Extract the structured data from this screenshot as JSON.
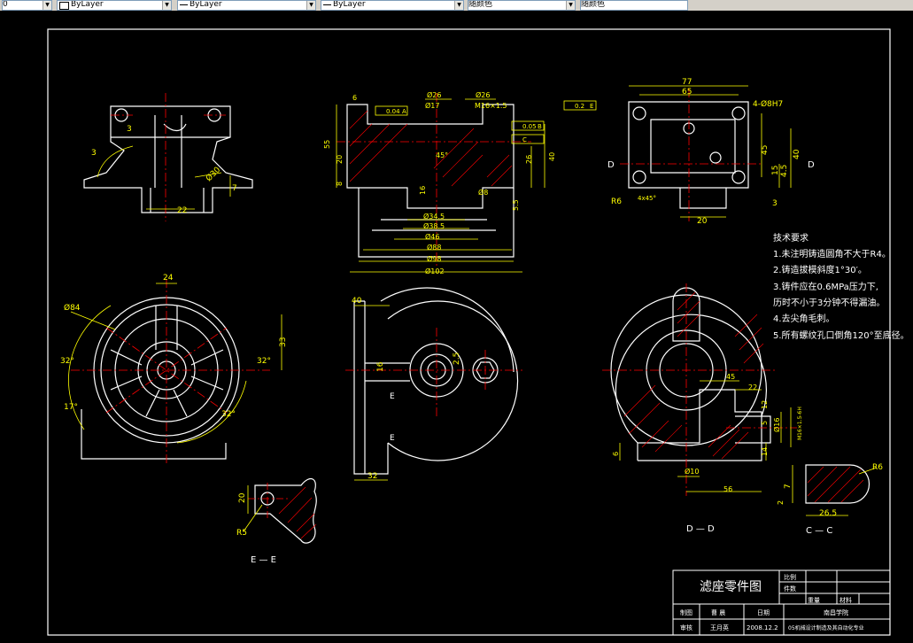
{
  "toolbar": {
    "layer_value": "0",
    "color_value": "ByLayer",
    "linetype_value": "ByLayer",
    "lineweight_value": "ByLayer",
    "plotstyle_value": "随颜色"
  },
  "colors": {
    "background": "#000000",
    "outline": "#ffffff",
    "dimension": "#ffff00",
    "centerline": "#ff0000",
    "hatch": "#ff0000",
    "border": "#ffffff"
  },
  "top_section": {
    "dims": {
      "d26a": "Ø26",
      "d17": "Ø17",
      "d26b": "Ø26",
      "t1": "6",
      "s55": "55",
      "s20": "20",
      "s8": "8",
      "s16": "16",
      "s5_5": "5.5",
      "s26": "26",
      "s40": "40",
      "s45": "45°",
      "d8": "Ø8",
      "m16": "M16×1.5",
      "d34_5": "Ø34.5",
      "d38_5": "Ø38.5",
      "d46": "Ø46",
      "d88": "Ø88",
      "d98": "Ø98",
      "d102": "Ø102",
      "tol_a": "0.04",
      "tol_b": "0.2",
      "tol_c": "0.05",
      "ref_a": "A",
      "ref_b": "B",
      "ref_e": "E",
      "ref_c": "C"
    }
  },
  "top_right_view": {
    "dims": {
      "w77": "77",
      "w65": "65",
      "holes": "4-Ø8H7",
      "h45": "45",
      "h40": "40",
      "h15": "15",
      "h4_5": "4.5",
      "h3": "3",
      "w20": "20",
      "r6": "R6",
      "c45": "4x45°",
      "sec_d_left": "D",
      "sec_d_right": "D"
    }
  },
  "top_left_view": {
    "dims": {
      "r3a": "3",
      "r3b": "3",
      "d30": "Ø30",
      "s7": "7",
      "w22": "22"
    }
  },
  "mid_left_view": {
    "dims": {
      "d84": "Ø84",
      "w24": "24",
      "h33": "33",
      "a32a": "32°",
      "a32b": "32°",
      "a32c": "32°",
      "a17": "17°"
    }
  },
  "mid_center_view": {
    "dims": {
      "w40": "40",
      "s16": "16",
      "r2_5": "2.5",
      "w32": "32",
      "sec_e_top": "E",
      "sec_e_bot": "E"
    }
  },
  "mid_right_view": {
    "dims": {
      "w45": "45",
      "w22": "22",
      "d16": "Ø16",
      "thread": "M16×1.5-6H",
      "d10": "Ø10",
      "w56": "56",
      "h6": "6",
      "h12": "12",
      "h5": "5",
      "h14": "14",
      "h2": "2"
    }
  },
  "section_e": {
    "label": "E — E",
    "dims": {
      "h20": "20",
      "r5": "R5"
    }
  },
  "section_d": {
    "label": "D — D"
  },
  "section_c": {
    "label": "C — C",
    "dims": {
      "r6": "R6",
      "w26_5": "26.5",
      "h7": "7"
    }
  },
  "tech_req": {
    "title": "技术要求",
    "items": [
      "1.未注明铸造圆角不大于R4。",
      "2.铸造拔模斜度1°30′。",
      "3.铸件应在0.6MPa压力下,",
      "历时不小于3分钟不得漏油。",
      "4.去尖角毛刺。",
      "5.所有螺纹孔口倒角120°至底径。"
    ]
  },
  "title_block": {
    "drawing_title": "滤座零件图",
    "ratio_label": "比例",
    "qty_label": "件数",
    "weight_label": "重量",
    "material_label": "材料",
    "designer_label": "制图",
    "designer_name": "曹  晨",
    "date_label": "日期",
    "checker_label": "审核",
    "checker_name": "王月英",
    "date_value": "2008.12.2",
    "school": "南昌学院",
    "project": "05机械设计制造及其自动化专业"
  }
}
